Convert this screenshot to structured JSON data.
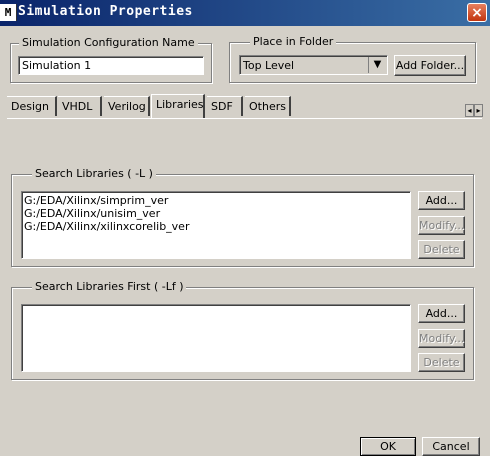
{
  "window": {
    "title": "Simulation Properties",
    "icon_glyph": "M",
    "close_glyph": "×"
  },
  "config_name": {
    "label": "Simulation Configuration Name",
    "value": "Simulation 1"
  },
  "place_in_folder": {
    "label": "Place in Folder",
    "selected": "Top Level",
    "add_folder_label": "Add Folder..."
  },
  "tabs": [
    {
      "label": "Design"
    },
    {
      "label": "VHDL"
    },
    {
      "label": "Verilog"
    },
    {
      "label": "Libraries",
      "active": true
    },
    {
      "label": "SDF"
    },
    {
      "label": "Others"
    }
  ],
  "tab_scroll": {
    "left": "◂",
    "right": "▸"
  },
  "search_libraries": {
    "label": "Search Libraries ( -L )",
    "items": [
      "G:/EDA/Xilinx/simprim_ver",
      "G:/EDA/Xilinx/unisim_ver",
      "G:/EDA/Xilinx/xilinxcorelib_ver"
    ],
    "add_label": "Add...",
    "modify_label": "Modify...",
    "delete_label": "Delete"
  },
  "search_libraries_first": {
    "label": "Search Libraries First ( -Lf )",
    "items": [],
    "add_label": "Add...",
    "modify_label": "Modify...",
    "delete_label": "Delete"
  },
  "footer": {
    "ok_label": "OK",
    "cancel_label": "Cancel"
  }
}
